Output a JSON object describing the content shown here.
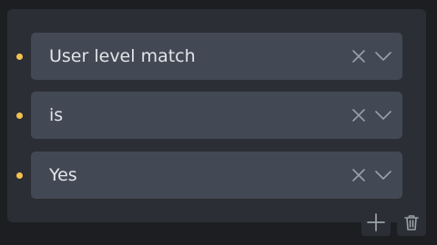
{
  "conditions": [
    {
      "value": "User level match"
    },
    {
      "value": "is"
    },
    {
      "value": "Yes"
    }
  ],
  "icons": {
    "bullet": "dot-icon",
    "clear": "close-icon",
    "expand": "chevron-down-icon",
    "add": "plus-icon",
    "delete": "trash-icon"
  },
  "colors": {
    "background": "#1c1e22",
    "panel": "#2b2e34",
    "select": "#434954",
    "text": "#e3e5e9",
    "bullet": "#f2c14e",
    "icon": "#9aa0aa"
  }
}
